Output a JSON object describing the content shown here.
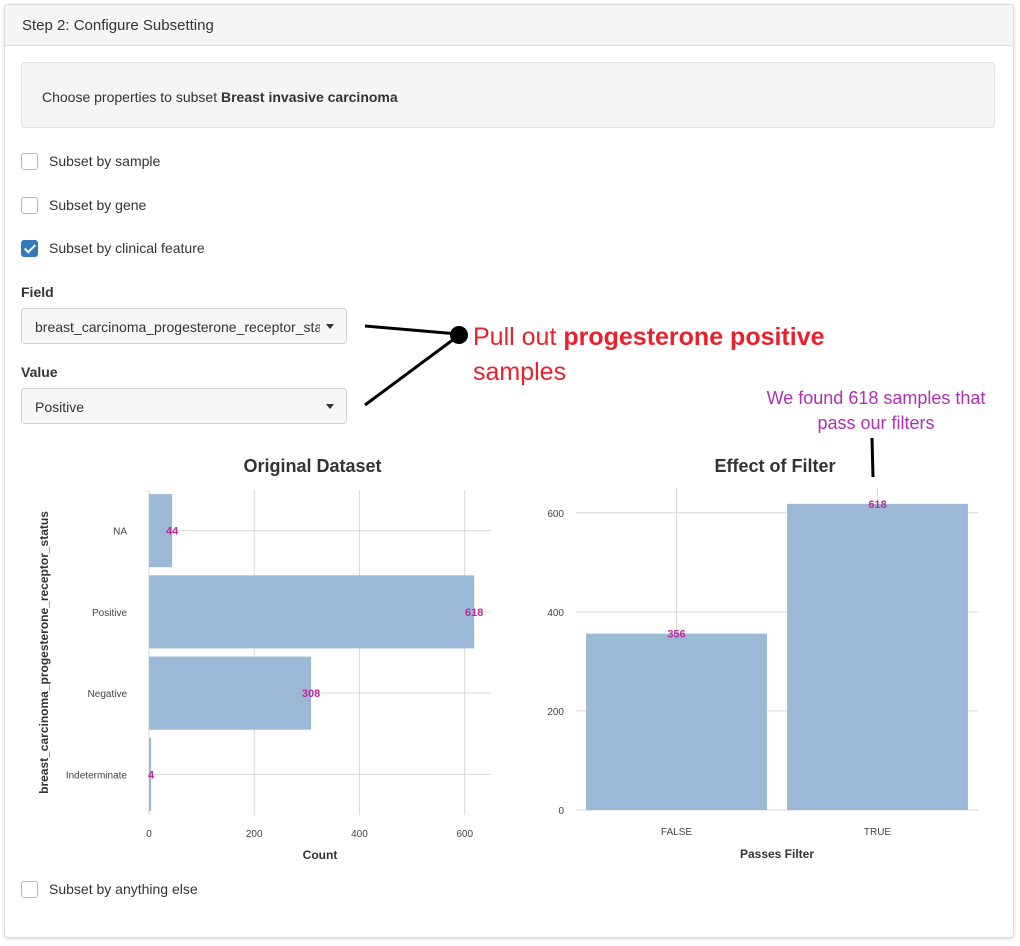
{
  "panel": {
    "title": "Step 2: Configure Subsetting"
  },
  "well": {
    "prefix": "Choose properties to subset ",
    "dataset": "Breast invasive carcinoma"
  },
  "options": {
    "sample": {
      "label": "Subset by sample",
      "checked": false
    },
    "gene": {
      "label": "Subset by gene",
      "checked": false
    },
    "clinical": {
      "label": "Subset by clinical feature",
      "checked": true
    },
    "other": {
      "label": "Subset by anything else",
      "checked": false
    }
  },
  "field": {
    "label": "Field",
    "value": "breast_carcinoma_progesterone_receptor_status"
  },
  "value_select": {
    "label": "Value",
    "value": "Positive"
  },
  "annotations": {
    "red_prefix": "Pull out ",
    "red_bold": "progesterone positive",
    "red_suffix": "samples",
    "purple_line1": "We found 618 samples that",
    "purple_line2": "pass our filters"
  },
  "colors": {
    "bar": "#9bb9d6",
    "label": "#c0299b",
    "grid": "#d9d9d9",
    "checked": "#337ab7",
    "annotation_red": "#e8212c",
    "annotation_purple": "#b030b5"
  },
  "chart_data": [
    {
      "type": "bar",
      "orientation": "horizontal",
      "title": "Original Dataset",
      "xlabel": "Count",
      "ylabel": "breast_carcinoma_progesterone_receptor_status",
      "categories": [
        "NA",
        "Positive",
        "Negative",
        "Indeterminate"
      ],
      "values": [
        44,
        618,
        308,
        4
      ],
      "xlim": [
        0,
        650
      ],
      "xticks": [
        0,
        200,
        400,
        600
      ],
      "grid": true
    },
    {
      "type": "bar",
      "orientation": "vertical",
      "title": "Effect of Filter",
      "xlabel": "Passes Filter",
      "ylabel": "",
      "categories": [
        "FALSE",
        "TRUE"
      ],
      "values": [
        356,
        618
      ],
      "ylim": [
        0,
        650
      ],
      "yticks": [
        0,
        200,
        400,
        600
      ],
      "grid": true
    }
  ]
}
